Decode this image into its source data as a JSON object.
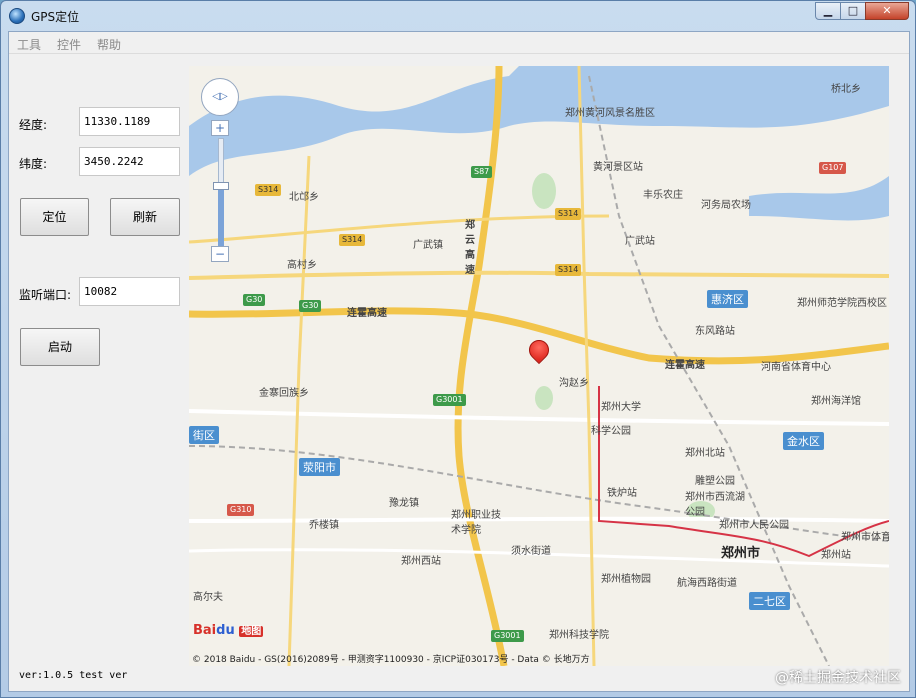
{
  "window": {
    "title": "GPS定位",
    "min_glyph": "▁",
    "max_glyph": "□",
    "close_glyph": "✕"
  },
  "menu": [
    "工具",
    "控件",
    "帮助"
  ],
  "form": {
    "longitude_label": "经度:",
    "longitude_value": "11330.1189",
    "latitude_label": "纬度:",
    "latitude_value": "3450.2242",
    "locate_button": "定位",
    "refresh_button": "刷新",
    "port_label": "监听端口:",
    "port_value": "10082",
    "start_button": "启动",
    "version": "ver:1.0.5 test ver"
  },
  "map": {
    "zoom_in": "+",
    "zoom_out": "−",
    "logo": {
      "bai": "Bai",
      "du": "du",
      "map": "地图"
    },
    "copyright": "© 2018 Baidu - GS(2016)2089号 - 甲测资字1100930 - 京ICP证030173号 - Data © 长地万方",
    "places": [
      "郑州黄河风景名胜区",
      "黄河景区站",
      "丰乐农庄",
      "河务局农场",
      "桥北乡",
      "北邙乡",
      "广武镇",
      "广武站",
      "高村乡",
      "郑州师范学院西校区",
      "东风路站",
      "河南省体育中心",
      "沟赵乡",
      "郑州大学",
      "科学公园",
      "郑州海洋馆",
      "金寨回族乡",
      "郑州北站",
      "雕塑公园",
      "郑州市西流湖公园",
      "铁炉站",
      "郑州市人民公园",
      "郑州市体育",
      "豫龙镇",
      "郑州职业技术学院",
      "乔楼镇",
      "须水街道",
      "郑州西站",
      "郑州站",
      "郑州植物园",
      "航海西路街道",
      "郑州科技学院",
      "郑州市",
      "高尔夫"
    ],
    "districts": [
      "惠济区",
      "金水区",
      "荥阳市",
      "二七区",
      "街区"
    ],
    "roads": [
      "连霍高速",
      "郑云高速",
      "S314",
      "S87",
      "G30",
      "G3001",
      "G107",
      "G310"
    ],
    "watermark": "@稀土掘金技术社区"
  }
}
